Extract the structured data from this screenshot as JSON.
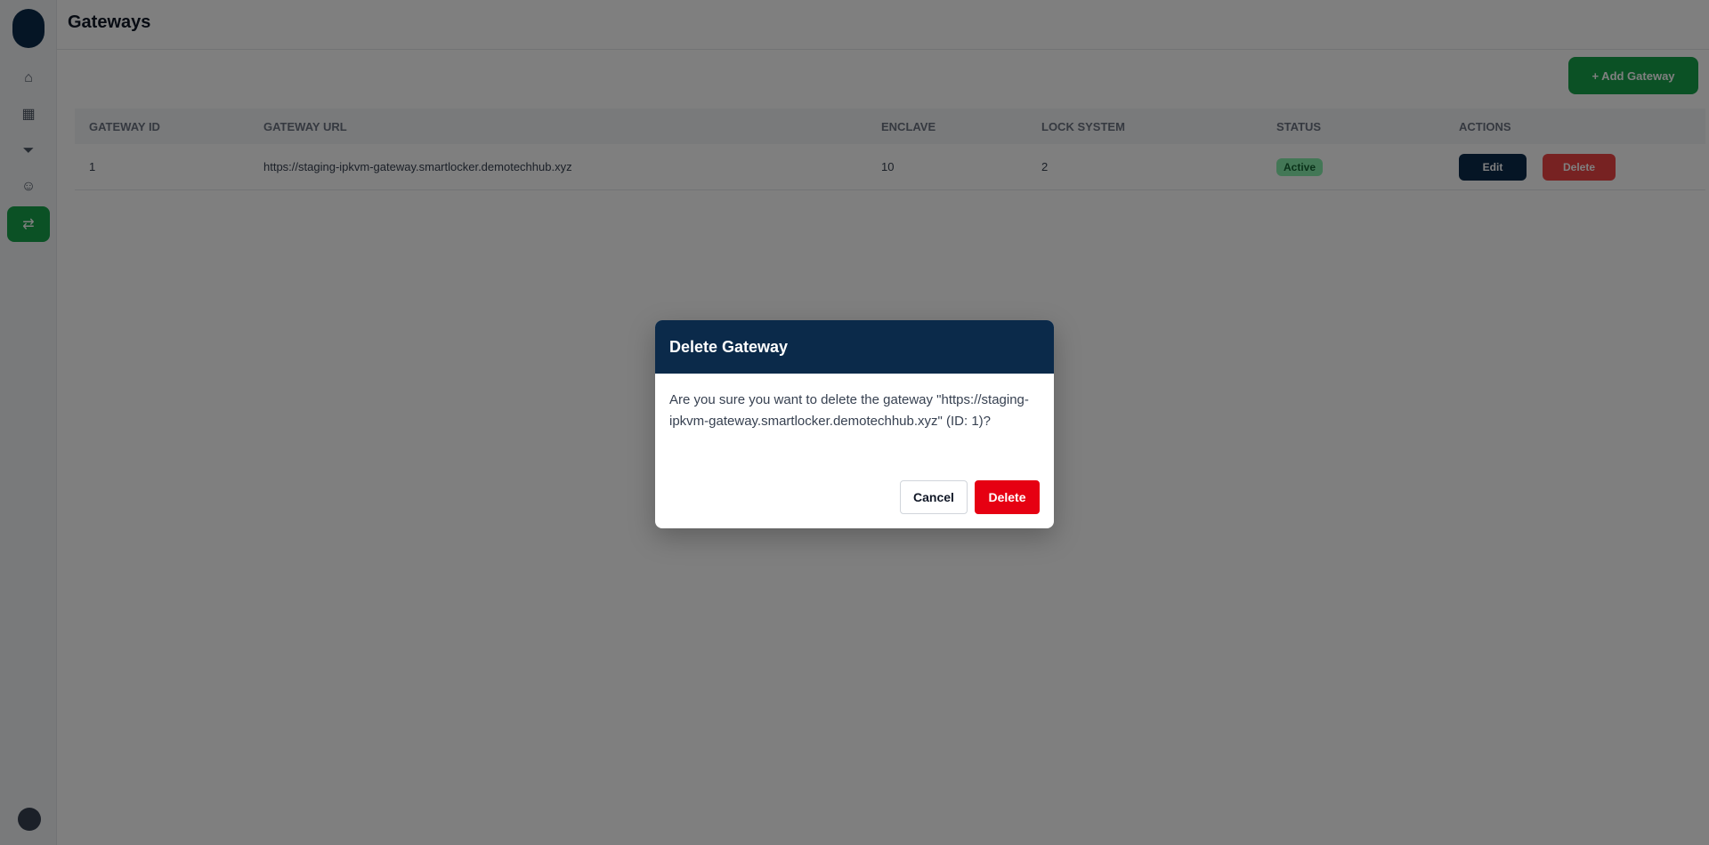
{
  "app": {
    "page_title": "Gateways",
    "add_button_label": "+ Add Gateway"
  },
  "sidebar": {
    "items": [
      {
        "icon": "home-icon"
      },
      {
        "icon": "grid-icon"
      },
      {
        "icon": "filter-icon"
      },
      {
        "icon": "user-icon"
      },
      {
        "icon": "gateway-icon",
        "active": true
      }
    ]
  },
  "table": {
    "headers": [
      "GATEWAY ID",
      "GATEWAY URL",
      "ENCLAVE",
      "LOCK SYSTEM",
      "STATUS",
      "ACTIONS"
    ],
    "rows": [
      {
        "id": "1",
        "url": "https://staging-ipkvm-gateway.smartlocker.demotechhub.xyz",
        "enclave": "10",
        "lock_system": "2",
        "status": "Active",
        "edit_label": "Edit",
        "delete_label": "Delete"
      }
    ]
  },
  "modal": {
    "title": "Delete Gateway",
    "message": "Are you sure you want to delete the gateway \"https://staging-ipkvm-gateway.smartlocker.demotechhub.xyz\" (ID: 1)?",
    "cancel_label": "Cancel",
    "delete_label": "Delete"
  },
  "colors": {
    "modal_header": "#0b2a4a",
    "delete_button": "#e60012",
    "primary_green": "#16a34a"
  }
}
